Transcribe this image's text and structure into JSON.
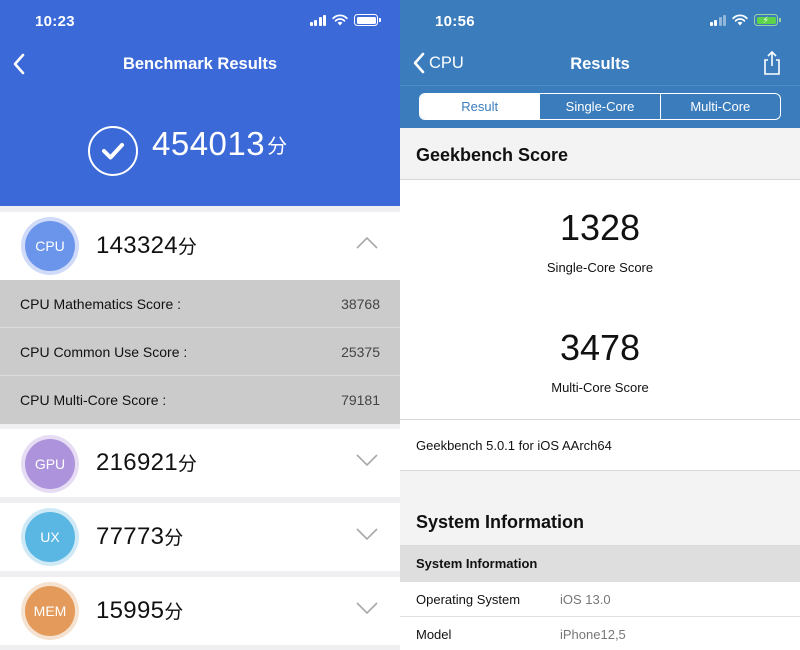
{
  "antutu": {
    "status_bar": {
      "time": "10:23"
    },
    "nav": {
      "title": "Benchmark Results",
      "back_icon": "chevron-left-icon"
    },
    "total": {
      "score": "454013",
      "unit": "分"
    },
    "colors": {
      "header": "#3b69d8",
      "cpu": "#6b94eb",
      "gpu": "#ad93db",
      "ux": "#5ab6e2",
      "mem": "#e39a5a"
    },
    "categories": [
      {
        "badge": "CPU",
        "score": "143324",
        "unit": "分",
        "expanded": true,
        "details": [
          {
            "label": "CPU Mathematics Score :",
            "value": "38768"
          },
          {
            "label": "CPU Common Use Score :",
            "value": "25375"
          },
          {
            "label": "CPU Multi-Core Score :",
            "value": "79181"
          }
        ]
      },
      {
        "badge": "GPU",
        "score": "216921",
        "unit": "分",
        "expanded": false
      },
      {
        "badge": "UX",
        "score": "77773",
        "unit": "分",
        "expanded": false
      },
      {
        "badge": "MEM",
        "score": "15995",
        "unit": "分",
        "expanded": false
      }
    ]
  },
  "geekbench": {
    "status_bar": {
      "time": "10:56"
    },
    "nav": {
      "back_label": "CPU",
      "title": "Results"
    },
    "colors": {
      "header": "#3a7cbc"
    },
    "tabs": [
      {
        "label": "Result",
        "active": true
      },
      {
        "label": "Single-Core",
        "active": false
      },
      {
        "label": "Multi-Core",
        "active": false
      }
    ],
    "score_section": {
      "title": "Geekbench Score",
      "single_core": {
        "value": "1328",
        "label": "Single-Core Score"
      },
      "multi_core": {
        "value": "3478",
        "label": "Multi-Core Score"
      },
      "version": "Geekbench 5.0.1 for iOS AArch64"
    },
    "system_section": {
      "title": "System Information",
      "table_header": "System Information",
      "rows": [
        {
          "key": "Operating System",
          "value": "iOS 13.0"
        },
        {
          "key": "Model",
          "value": "iPhone12,5"
        }
      ]
    }
  }
}
